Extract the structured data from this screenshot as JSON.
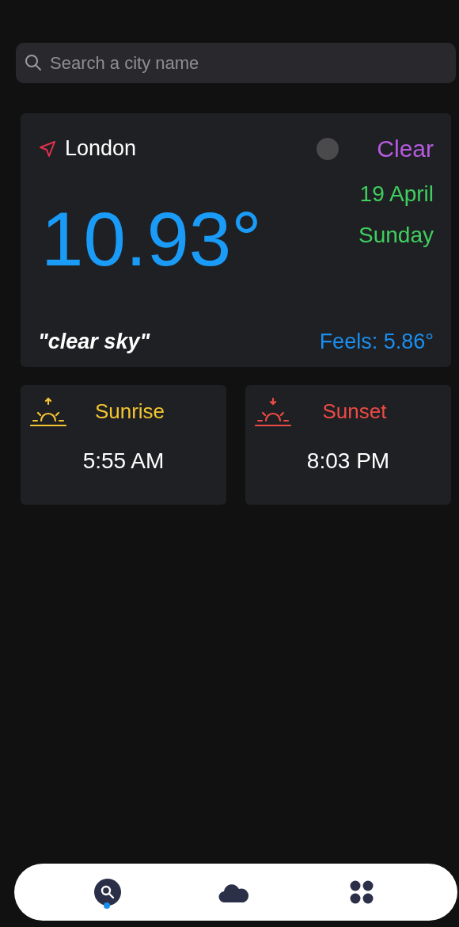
{
  "search": {
    "placeholder": "Search a city name"
  },
  "weather": {
    "city": "London",
    "condition": "Clear",
    "temperature": "10.93°",
    "date": "19 April",
    "day": "Sunday",
    "description": "\"clear sky\"",
    "feels": "Feels: 5.86°"
  },
  "sun_cards": [
    {
      "kind": "sunrise",
      "label": "Sunrise",
      "time": "5:55 AM"
    },
    {
      "kind": "sunset",
      "label": "Sunset",
      "time": "8:03 PM"
    }
  ],
  "nav": [
    {
      "kind": "search",
      "selected": true
    },
    {
      "kind": "weather",
      "selected": false
    },
    {
      "kind": "apps",
      "selected": false
    }
  ]
}
